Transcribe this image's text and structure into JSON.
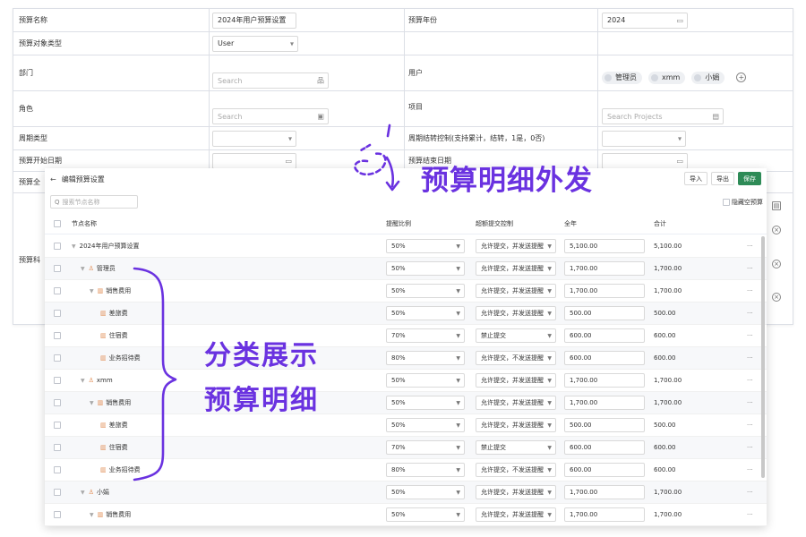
{
  "form": {
    "budget_name_label": "预算名称",
    "budget_name_value": "2024年用户预算设置",
    "budget_year_label": "预算年份",
    "budget_year_value": "2024",
    "object_type_label": "预算对象类型",
    "object_type_value": "User",
    "dept_label": "部门",
    "dept_placeholder": "Search",
    "user_label": "用户",
    "user_tags": [
      "管理员",
      "xmm",
      "小娟"
    ],
    "role_label": "角色",
    "role_placeholder": "Search",
    "project_label": "项目",
    "project_placeholder": "Search Projects",
    "period_type_label": "周期类型",
    "period_carry_label": "周期结转控制(支持累计，结转，1是，0否)",
    "start_date_label": "预算开始日期",
    "end_date_label": "预算结束日期",
    "budget_all_label": "预算全",
    "budget_subject_label": "预算科"
  },
  "annotations": {
    "title": "预算明细外发",
    "side_line1": "分类展示",
    "side_line2": "预算明细"
  },
  "panel": {
    "back_label": "←",
    "title": "编辑预算设置",
    "import_label": "导入",
    "export_label": "导出",
    "save_label": "保存",
    "search_placeholder": "搜索节点名称",
    "hide_zero_label": "隐藏空预算",
    "headers": {
      "name": "节点名称",
      "ratio": "提醒比例",
      "ctrl": "超额提交控制",
      "year": "全年",
      "sum": "合计"
    },
    "more_label": "···",
    "rows": [
      {
        "name": "2024年用户预算设置",
        "kind": "root",
        "ratio": "50%",
        "ctrl": "允许提交，并发送提醒",
        "year": "5,100.00",
        "sum": "5,100.00"
      },
      {
        "name": "管理员",
        "kind": "user",
        "ratio": "50%",
        "ctrl": "允许提交，并发送提醒",
        "year": "1,700.00",
        "sum": "1,700.00"
      },
      {
        "name": "销售费用",
        "kind": "folder",
        "ratio": "50%",
        "ctrl": "允许提交，并发送提醒",
        "year": "1,700.00",
        "sum": "1,700.00"
      },
      {
        "name": "差旅费",
        "kind": "leaf",
        "ratio": "50%",
        "ctrl": "允许提交，并发送提醒",
        "year": "500.00",
        "sum": "500.00"
      },
      {
        "name": "住宿费",
        "kind": "leaf",
        "ratio": "70%",
        "ctrl": "禁止提交",
        "year": "600.00",
        "sum": "600.00"
      },
      {
        "name": "业务招待费",
        "kind": "leaf",
        "ratio": "80%",
        "ctrl": "允许提交，不发送提醒",
        "year": "600.00",
        "sum": "600.00"
      },
      {
        "name": "xmm",
        "kind": "user",
        "ratio": "50%",
        "ctrl": "允许提交，并发送提醒",
        "year": "1,700.00",
        "sum": "1,700.00"
      },
      {
        "name": "销售费用",
        "kind": "folder",
        "ratio": "50%",
        "ctrl": "允许提交，并发送提醒",
        "year": "1,700.00",
        "sum": "1,700.00"
      },
      {
        "name": "差旅费",
        "kind": "leaf",
        "ratio": "50%",
        "ctrl": "允许提交，并发送提醒",
        "year": "500.00",
        "sum": "500.00"
      },
      {
        "name": "住宿费",
        "kind": "leaf",
        "ratio": "70%",
        "ctrl": "禁止提交",
        "year": "600.00",
        "sum": "600.00"
      },
      {
        "name": "业务招待费",
        "kind": "leaf",
        "ratio": "80%",
        "ctrl": "允许提交，不发送提醒",
        "year": "600.00",
        "sum": "600.00"
      },
      {
        "name": "小娟",
        "kind": "user",
        "ratio": "50%",
        "ctrl": "允许提交，并发送提醒",
        "year": "1,700.00",
        "sum": "1,700.00"
      },
      {
        "name": "销售费用",
        "kind": "folder",
        "ratio": "50%",
        "ctrl": "允许提交，并发送提醒",
        "year": "1,700.00",
        "sum": "1,700.00"
      }
    ]
  },
  "colors": {
    "accent": "#6a32e0",
    "save": "#2e8b57",
    "node_icon": "#e08a50"
  }
}
